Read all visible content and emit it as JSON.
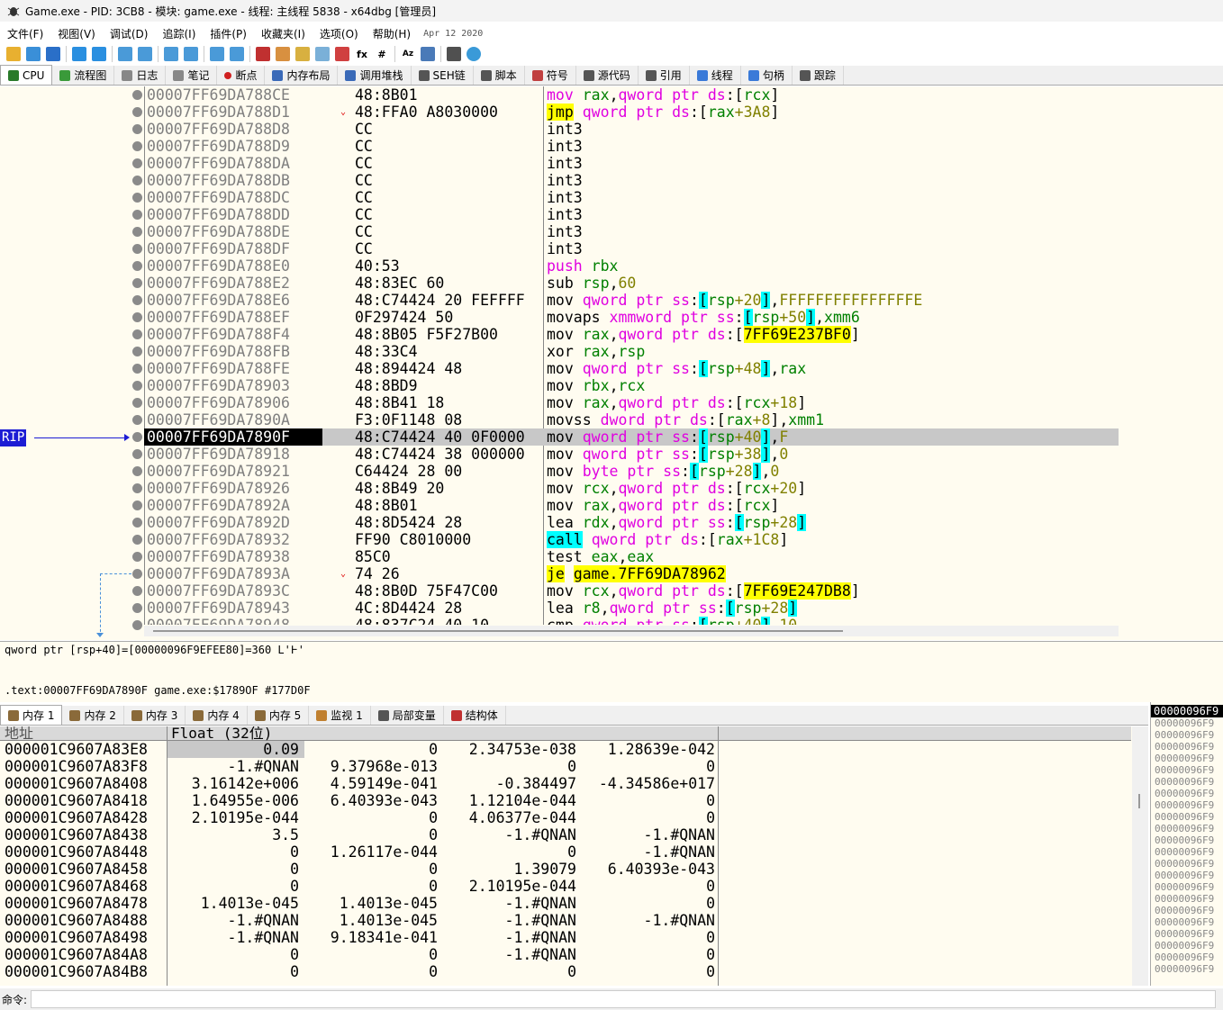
{
  "title": "Game.exe - PID: 3CB8 - 模块: game.exe - 线程: 主线程 5838 - x64dbg [管理员]",
  "menu": [
    "文件(F)",
    "视图(V)",
    "调试(D)",
    "追踪(I)",
    "插件(P)",
    "收藏夹(I)",
    "选项(O)",
    "帮助(H)"
  ],
  "menu_date": "Apr 12 2020",
  "tabs": [
    "CPU",
    "流程图",
    "日志",
    "笔记",
    "断点",
    "内存布局",
    "调用堆栈",
    "SEH链",
    "脚本",
    "符号",
    "源代码",
    "引用",
    "线程",
    "句柄",
    "跟踪"
  ],
  "rip_label": "RIP",
  "disasm": [
    {
      "addr": "00007FF69DA788CE",
      "bytes": "48:8B01",
      "ins": [
        [
          "k",
          "mov "
        ],
        [
          "r",
          "rax"
        ],
        [
          "",
          ","
        ],
        [
          "k",
          "qword ptr "
        ],
        [
          "k",
          "ds"
        ],
        [
          "",
          ":["
        ],
        [
          "r",
          "rcx"
        ],
        [
          "",
          "]"
        ]
      ]
    },
    {
      "addr": "00007FF69DA788D1",
      "bytes": "48:FFA0 A8030000",
      "arrow": "⌄",
      "ins": [
        [
          "hly",
          "jmp"
        ],
        [
          "",
          " "
        ],
        [
          "k",
          "qword ptr "
        ],
        [
          "k",
          "ds"
        ],
        [
          "",
          ":["
        ],
        [
          "r",
          "rax"
        ],
        [
          "n",
          "+3A8"
        ],
        [
          "",
          "]"
        ]
      ]
    },
    {
      "addr": "00007FF69DA788D8",
      "bytes": "CC",
      "ins": [
        [
          "",
          "int3"
        ]
      ]
    },
    {
      "addr": "00007FF69DA788D9",
      "bytes": "CC",
      "ins": [
        [
          "",
          "int3"
        ]
      ]
    },
    {
      "addr": "00007FF69DA788DA",
      "bytes": "CC",
      "ins": [
        [
          "",
          "int3"
        ]
      ]
    },
    {
      "addr": "00007FF69DA788DB",
      "bytes": "CC",
      "ins": [
        [
          "",
          "int3"
        ]
      ]
    },
    {
      "addr": "00007FF69DA788DC",
      "bytes": "CC",
      "ins": [
        [
          "",
          "int3"
        ]
      ]
    },
    {
      "addr": "00007FF69DA788DD",
      "bytes": "CC",
      "ins": [
        [
          "",
          "int3"
        ]
      ]
    },
    {
      "addr": "00007FF69DA788DE",
      "bytes": "CC",
      "ins": [
        [
          "",
          "int3"
        ]
      ]
    },
    {
      "addr": "00007FF69DA788DF",
      "bytes": "CC",
      "ins": [
        [
          "",
          "int3"
        ]
      ]
    },
    {
      "addr": "00007FF69DA788E0",
      "bytes": "40:53",
      "ins": [
        [
          "b",
          "push "
        ],
        [
          "r",
          "rbx"
        ]
      ]
    },
    {
      "addr": "00007FF69DA788E2",
      "bytes": "48:83EC 60",
      "ins": [
        [
          "",
          "sub "
        ],
        [
          "r",
          "rsp"
        ],
        [
          "",
          ","
        ],
        [
          "n",
          "60"
        ]
      ]
    },
    {
      "addr": "00007FF69DA788E6",
      "bytes": "48:C74424 20 FEFFFF",
      "ins": [
        [
          "",
          "mov "
        ],
        [
          "k",
          "qword ptr "
        ],
        [
          "k",
          "ss"
        ],
        [
          "",
          ":"
        ],
        [
          "hlc",
          "["
        ],
        [
          "r",
          "rsp"
        ],
        [
          "n",
          "+20"
        ],
        [
          "hlc",
          "]"
        ],
        [
          "",
          ","
        ],
        [
          "n",
          "FFFFFFFFFFFFFFFE"
        ]
      ]
    },
    {
      "addr": "00007FF69DA788EF",
      "bytes": "0F297424 50",
      "ins": [
        [
          "",
          "movaps "
        ],
        [
          "k",
          "xmmword ptr "
        ],
        [
          "k",
          "ss"
        ],
        [
          "",
          ":"
        ],
        [
          "hlc",
          "["
        ],
        [
          "r",
          "rsp"
        ],
        [
          "n",
          "+50"
        ],
        [
          "hlc",
          "]"
        ],
        [
          "",
          ","
        ],
        [
          "r",
          "xmm6"
        ]
      ]
    },
    {
      "addr": "00007FF69DA788F4",
      "bytes": "48:8B05 F5F27B00",
      "ins": [
        [
          "",
          "mov "
        ],
        [
          "r",
          "rax"
        ],
        [
          "",
          ","
        ],
        [
          "k",
          "qword ptr "
        ],
        [
          "k",
          "ds"
        ],
        [
          "",
          ":["
        ],
        [
          "hly",
          "7FF69E237BF0"
        ],
        [
          "",
          "]"
        ]
      ]
    },
    {
      "addr": "00007FF69DA788FB",
      "bytes": "48:33C4",
      "ins": [
        [
          "",
          "xor "
        ],
        [
          "r",
          "rax"
        ],
        [
          "",
          ","
        ],
        [
          "r",
          "rsp"
        ]
      ]
    },
    {
      "addr": "00007FF69DA788FE",
      "bytes": "48:894424 48",
      "ins": [
        [
          "",
          "mov "
        ],
        [
          "k",
          "qword ptr "
        ],
        [
          "k",
          "ss"
        ],
        [
          "",
          ":"
        ],
        [
          "hlc",
          "["
        ],
        [
          "r",
          "rsp"
        ],
        [
          "n",
          "+48"
        ],
        [
          "hlc",
          "]"
        ],
        [
          "",
          ","
        ],
        [
          "r",
          "rax"
        ]
      ]
    },
    {
      "addr": "00007FF69DA78903",
      "bytes": "48:8BD9",
      "ins": [
        [
          "",
          "mov "
        ],
        [
          "r",
          "rbx"
        ],
        [
          "",
          ","
        ],
        [
          "r",
          "rcx"
        ]
      ]
    },
    {
      "addr": "00007FF69DA78906",
      "bytes": "48:8B41 18",
      "ins": [
        [
          "",
          "mov "
        ],
        [
          "r",
          "rax"
        ],
        [
          "",
          ","
        ],
        [
          "k",
          "qword ptr "
        ],
        [
          "k",
          "ds"
        ],
        [
          "",
          ":["
        ],
        [
          "r",
          "rcx"
        ],
        [
          "n",
          "+18"
        ],
        [
          "",
          "]"
        ]
      ]
    },
    {
      "addr": "00007FF69DA7890A",
      "bytes": "F3:0F1148 08",
      "ins": [
        [
          "",
          "movss "
        ],
        [
          "k",
          "dword ptr "
        ],
        [
          "k",
          "ds"
        ],
        [
          "",
          ":["
        ],
        [
          "r",
          "rax"
        ],
        [
          "n",
          "+8"
        ],
        [
          "",
          "],"
        ],
        [
          "r",
          "xmm1"
        ]
      ]
    },
    {
      "addr": "00007FF69DA7890F",
      "bytes": "48:C74424 40 0F0000",
      "rip": true,
      "ins": [
        [
          "",
          "mov "
        ],
        [
          "k",
          "qword ptr "
        ],
        [
          "k",
          "ss"
        ],
        [
          "",
          ":"
        ],
        [
          "hlc",
          "["
        ],
        [
          "r",
          "rsp"
        ],
        [
          "n",
          "+40"
        ],
        [
          "hlc",
          "]"
        ],
        [
          "",
          ","
        ],
        [
          "n",
          "F"
        ]
      ]
    },
    {
      "addr": "00007FF69DA78918",
      "bytes": "48:C74424 38 000000",
      "ins": [
        [
          "",
          "mov "
        ],
        [
          "k",
          "qword ptr "
        ],
        [
          "k",
          "ss"
        ],
        [
          "",
          ":"
        ],
        [
          "hlc",
          "["
        ],
        [
          "r",
          "rsp"
        ],
        [
          "n",
          "+38"
        ],
        [
          "hlc",
          "]"
        ],
        [
          "",
          ","
        ],
        [
          "n",
          "0"
        ]
      ]
    },
    {
      "addr": "00007FF69DA78921",
      "bytes": "C64424 28 00",
      "ins": [
        [
          "",
          "mov "
        ],
        [
          "k",
          "byte ptr "
        ],
        [
          "k",
          "ss"
        ],
        [
          "",
          ":"
        ],
        [
          "hlc",
          "["
        ],
        [
          "r",
          "rsp"
        ],
        [
          "n",
          "+28"
        ],
        [
          "hlc",
          "]"
        ],
        [
          "",
          ","
        ],
        [
          "n",
          "0"
        ]
      ]
    },
    {
      "addr": "00007FF69DA78926",
      "bytes": "48:8B49 20",
      "ins": [
        [
          "",
          "mov "
        ],
        [
          "r",
          "rcx"
        ],
        [
          "",
          ","
        ],
        [
          "k",
          "qword ptr "
        ],
        [
          "k",
          "ds"
        ],
        [
          "",
          ":["
        ],
        [
          "r",
          "rcx"
        ],
        [
          "n",
          "+20"
        ],
        [
          "",
          "]"
        ]
      ]
    },
    {
      "addr": "00007FF69DA7892A",
      "bytes": "48:8B01",
      "ins": [
        [
          "",
          "mov "
        ],
        [
          "r",
          "rax"
        ],
        [
          "",
          ","
        ],
        [
          "k",
          "qword ptr "
        ],
        [
          "k",
          "ds"
        ],
        [
          "",
          ":["
        ],
        [
          "r",
          "rcx"
        ],
        [
          "",
          "]"
        ]
      ]
    },
    {
      "addr": "00007FF69DA7892D",
      "bytes": "48:8D5424 28",
      "ins": [
        [
          "",
          "lea "
        ],
        [
          "r",
          "rdx"
        ],
        [
          "",
          ","
        ],
        [
          "k",
          "qword ptr "
        ],
        [
          "k",
          "ss"
        ],
        [
          "",
          ":"
        ],
        [
          "hlc",
          "["
        ],
        [
          "r",
          "rsp"
        ],
        [
          "n",
          "+28"
        ],
        [
          "hlc",
          "]"
        ]
      ]
    },
    {
      "addr": "00007FF69DA78932",
      "bytes": "FF90 C8010000",
      "ins": [
        [
          "hlc",
          "call"
        ],
        [
          "",
          " "
        ],
        [
          "k",
          "qword ptr "
        ],
        [
          "k",
          "ds"
        ],
        [
          "",
          ":["
        ],
        [
          "r",
          "rax"
        ],
        [
          "n",
          "+1C8"
        ],
        [
          "",
          "]"
        ]
      ]
    },
    {
      "addr": "00007FF69DA78938",
      "bytes": "85C0",
      "ins": [
        [
          "",
          "test "
        ],
        [
          "r",
          "eax"
        ],
        [
          "",
          ","
        ],
        [
          "r",
          "eax"
        ]
      ]
    },
    {
      "addr": "00007FF69DA7893A",
      "bytes": "74 26",
      "arrow": "⌄",
      "ins": [
        [
          "hlj",
          "je"
        ],
        [
          "",
          " "
        ],
        [
          "hly",
          "game.7FF69DA78962"
        ]
      ]
    },
    {
      "addr": "00007FF69DA7893C",
      "bytes": "48:8B0D 75F47C00",
      "ins": [
        [
          "",
          "mov "
        ],
        [
          "r",
          "rcx"
        ],
        [
          "",
          ","
        ],
        [
          "k",
          "qword ptr "
        ],
        [
          "k",
          "ds"
        ],
        [
          "",
          ":["
        ],
        [
          "hly",
          "7FF69E247DB8"
        ],
        [
          "",
          "]"
        ]
      ]
    },
    {
      "addr": "00007FF69DA78943",
      "bytes": "4C:8D4424 28",
      "ins": [
        [
          "",
          "lea "
        ],
        [
          "r",
          "r8"
        ],
        [
          "",
          ","
        ],
        [
          "k",
          "qword ptr "
        ],
        [
          "k",
          "ss"
        ],
        [
          "",
          ":"
        ],
        [
          "hlc",
          "["
        ],
        [
          "r",
          "rsp"
        ],
        [
          "n",
          "+28"
        ],
        [
          "hlc",
          "]"
        ]
      ]
    },
    {
      "addr": "00007FF69DA78948",
      "bytes": "48:837C24 40 10",
      "ins": [
        [
          "",
          "cmp "
        ],
        [
          "k",
          "qword ptr "
        ],
        [
          "k",
          "ss"
        ],
        [
          "",
          ":"
        ],
        [
          "hlc",
          "["
        ],
        [
          "r",
          "rsp"
        ],
        [
          "n",
          "+40"
        ],
        [
          "hlc",
          "]"
        ],
        [
          "",
          ","
        ],
        [
          "n",
          "10"
        ]
      ]
    }
  ],
  "info_line1": "qword ptr [rsp+40]=[00000096F9EFEE80]=360 L'Ͱ'",
  "info_line2": ".text:00007FF69DA7890F game.exe:$1789OF #177D0F",
  "memtabs": [
    "内存 1",
    "内存 2",
    "内存 3",
    "内存 4",
    "内存 5",
    "监视 1",
    "局部变量",
    "结构体"
  ],
  "mem_header": {
    "addr": "地址",
    "type": "Float (32位)"
  },
  "mem_rows": [
    {
      "addr": "000001C9607A83E8",
      "v": [
        "0.09",
        "0",
        "2.34753e-038",
        "1.28639e-042"
      ]
    },
    {
      "addr": "000001C9607A83F8",
      "v": [
        "-1.#QNAN",
        "9.37968e-013",
        "0",
        "0"
      ]
    },
    {
      "addr": "000001C9607A8408",
      "v": [
        "3.16142e+006",
        "4.59149e-041",
        "-0.384497",
        "-4.34586e+017"
      ]
    },
    {
      "addr": "000001C9607A8418",
      "v": [
        "1.64955e-006",
        "6.40393e-043",
        "1.12104e-044",
        "0"
      ]
    },
    {
      "addr": "000001C9607A8428",
      "v": [
        "2.10195e-044",
        "0",
        "4.06377e-044",
        "0"
      ]
    },
    {
      "addr": "000001C9607A8438",
      "v": [
        "3.5",
        "0",
        "-1.#QNAN",
        "-1.#QNAN"
      ]
    },
    {
      "addr": "000001C9607A8448",
      "v": [
        "0",
        "1.26117e-044",
        "0",
        "-1.#QNAN"
      ]
    },
    {
      "addr": "000001C9607A8458",
      "v": [
        "0",
        "0",
        "1.39079",
        "6.40393e-043"
      ]
    },
    {
      "addr": "000001C9607A8468",
      "v": [
        "0",
        "0",
        "2.10195e-044",
        "0"
      ]
    },
    {
      "addr": "000001C9607A8478",
      "v": [
        "1.4013e-045",
        "1.4013e-045",
        "-1.#QNAN",
        "0"
      ]
    },
    {
      "addr": "000001C9607A8488",
      "v": [
        "-1.#QNAN",
        "1.4013e-045",
        "-1.#QNAN",
        "-1.#QNAN"
      ]
    },
    {
      "addr": "000001C9607A8498",
      "v": [
        "-1.#QNAN",
        "9.18341e-041",
        "-1.#QNAN",
        "0"
      ]
    },
    {
      "addr": "000001C9607A84A8",
      "v": [
        "0",
        "0",
        "-1.#QNAN",
        "0"
      ]
    },
    {
      "addr": "000001C9607A84B8",
      "v": [
        "0",
        "0",
        "0",
        "0"
      ]
    }
  ],
  "stack_header": "00000096F9",
  "stack_rows": [
    "00000096F9",
    "00000096F9",
    "00000096F9",
    "00000096F9",
    "00000096F9",
    "00000096F9",
    "00000096F9",
    "00000096F9",
    "00000096F9",
    "00000096F9",
    "00000096F9",
    "00000096F9",
    "00000096F9",
    "00000096F9",
    "00000096F9",
    "00000096F9",
    "00000096F9",
    "00000096F9",
    "00000096F9",
    "00000096F9",
    "00000096F9",
    "00000096F9"
  ],
  "cmd_label": "命令:"
}
